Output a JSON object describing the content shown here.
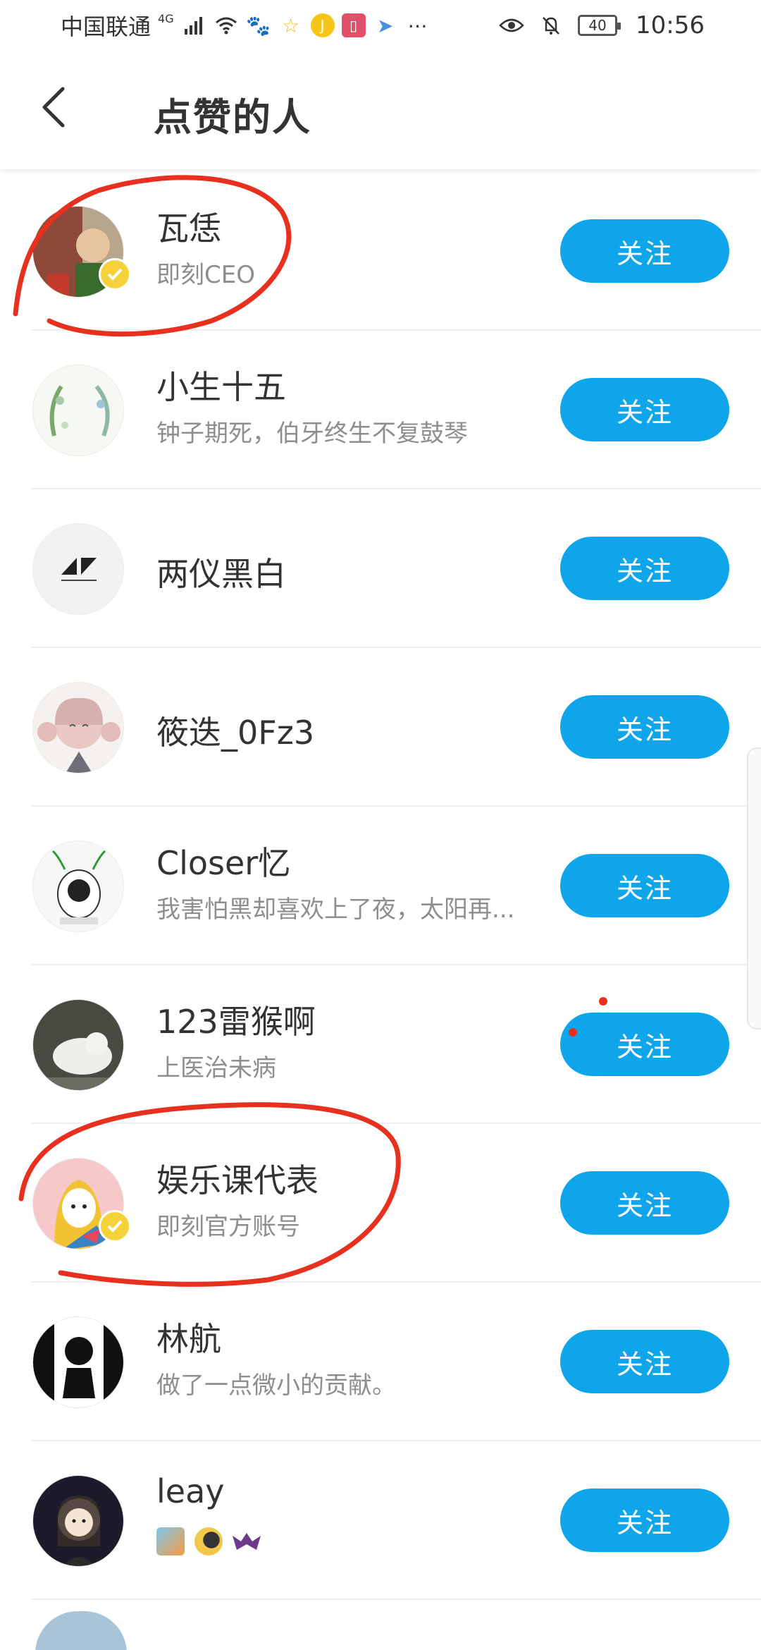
{
  "status_bar": {
    "carrier": "中国联通",
    "network": "4G",
    "time": "10:56",
    "battery": "40"
  },
  "header": {
    "title": "点赞的人"
  },
  "follow_label": "关注",
  "users": [
    {
      "name": "瓦恁",
      "subtitle": "即刻CEO",
      "verified": true
    },
    {
      "name": "小生十五",
      "subtitle": "钟子期死，伯牙终生不复鼓琴",
      "verified": false
    },
    {
      "name": "两仪黑白",
      "subtitle": "",
      "verified": false
    },
    {
      "name": "筱迭_0Fz3",
      "subtitle": "",
      "verified": false
    },
    {
      "name": "Closer忆",
      "subtitle": "我害怕黑却喜欢上了夜，太阳再...",
      "verified": false
    },
    {
      "name": "123雷猴啊",
      "subtitle": "上医治未病",
      "verified": false
    },
    {
      "name": "娱乐课代表",
      "subtitle": "即刻官方账号",
      "verified": true
    },
    {
      "name": "林航",
      "subtitle": "做了一点微小的贡献。",
      "verified": false
    },
    {
      "name": "leay",
      "subtitle": "",
      "verified": false
    }
  ],
  "colors": {
    "accent": "#0ea5ea",
    "annotation": "#e8301e",
    "verified_badge": "#f5d23a"
  }
}
